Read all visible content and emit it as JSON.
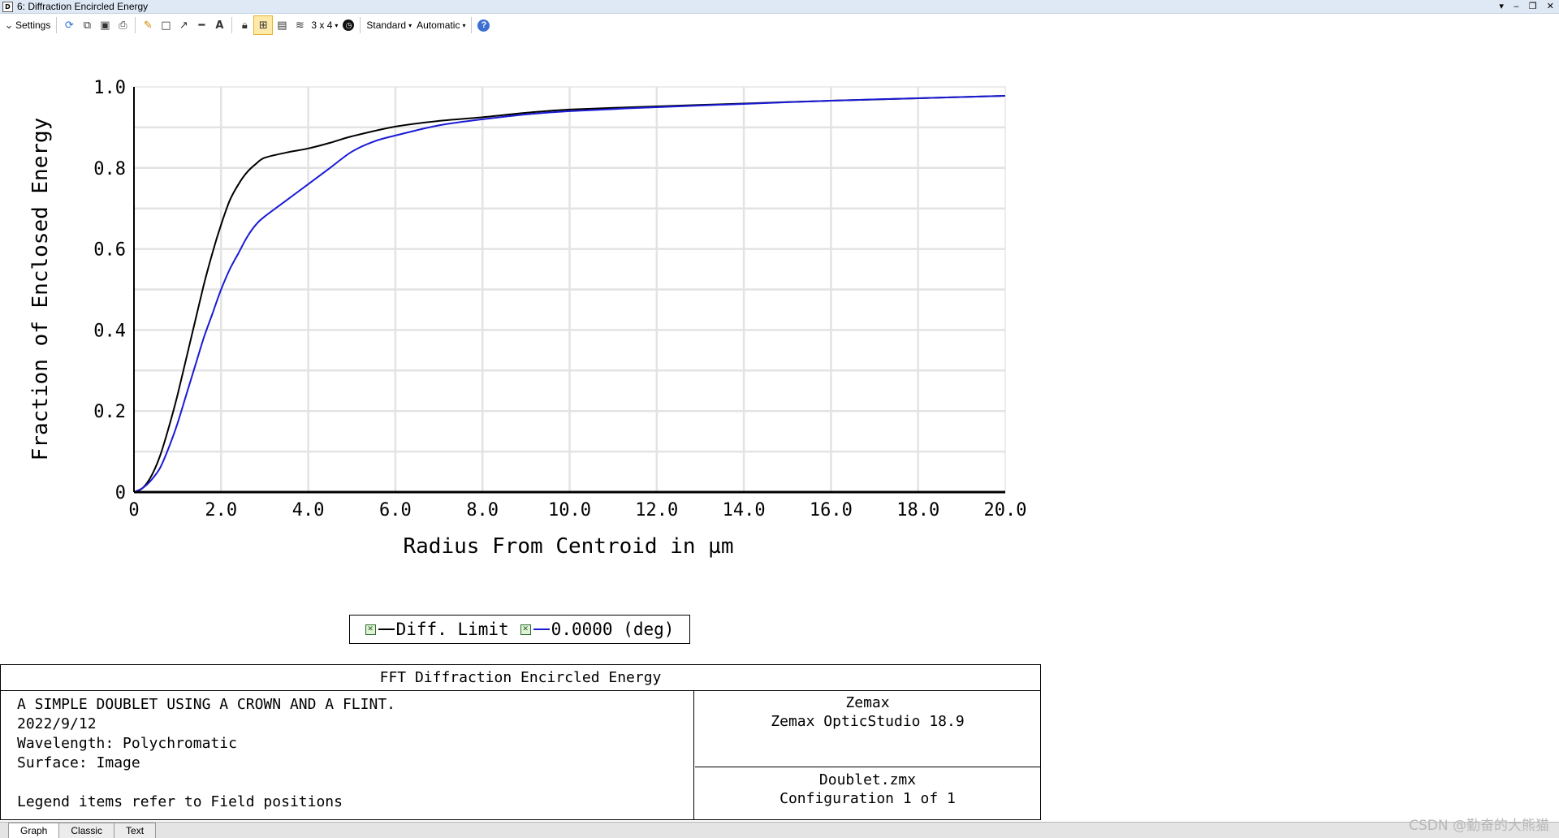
{
  "window": {
    "title": "6: Diffraction Encircled Energy",
    "icon_letter": "D"
  },
  "toolbar": {
    "settings_label": "Settings",
    "grid_label": "3 x 4",
    "standard_label": "Standard",
    "automatic_label": "Automatic"
  },
  "legend": {
    "item1": "Diff. Limit",
    "item2": "0.0000 (deg)",
    "item1_color": "#000000",
    "item2_color": "#1a1ad6"
  },
  "info": {
    "title": "FFT Diffraction Encircled Energy",
    "left_lines": [
      "A SIMPLE DOUBLET USING A CROWN AND A FLINT.",
      "2022/9/12",
      "Wavelength: Polychromatic",
      "Surface: Image",
      "Legend items refer to Field positions"
    ],
    "right_top": [
      "Zemax",
      "Zemax OpticStudio 18.9"
    ],
    "right_bottom": [
      "Doublet.zmx",
      "Configuration 1 of 1"
    ]
  },
  "tabs": [
    "Graph",
    "Classic",
    "Text"
  ],
  "watermark": "CSDN @勤奋的大熊猫",
  "chart_data": {
    "type": "line",
    "xlabel": "Radius From Centroid in µm",
    "ylabel": "Fraction of Enclosed Energy",
    "xlim": [
      0,
      20
    ],
    "ylim": [
      0,
      1
    ],
    "x_ticks": [
      "0",
      "2.0",
      "4.0",
      "6.0",
      "8.0",
      "10.0",
      "12.0",
      "14.0",
      "16.0",
      "18.0",
      "20.0"
    ],
    "y_ticks": [
      "0",
      "0.2",
      "0.4",
      "0.6",
      "0.8",
      "1.0"
    ],
    "grid": true,
    "series": [
      {
        "name": "Diff. Limit",
        "color": "#000000",
        "x": [
          0,
          0.2,
          0.4,
          0.6,
          0.8,
          1.0,
          1.2,
          1.4,
          1.6,
          1.8,
          2.0,
          2.2,
          2.4,
          2.6,
          2.8,
          3.0,
          3.5,
          4.0,
          4.5,
          5.0,
          6.0,
          7.0,
          8.0,
          9.0,
          10.0,
          12.0,
          14.0,
          16.0,
          18.0,
          20.0
        ],
        "y": [
          0,
          0.01,
          0.04,
          0.09,
          0.16,
          0.24,
          0.33,
          0.42,
          0.51,
          0.59,
          0.66,
          0.72,
          0.76,
          0.79,
          0.81,
          0.825,
          0.838,
          0.848,
          0.862,
          0.878,
          0.902,
          0.916,
          0.925,
          0.936,
          0.944,
          0.952,
          0.959,
          0.966,
          0.972,
          0.978
        ]
      },
      {
        "name": "0.0000 (deg)",
        "color": "#1a1ad6",
        "x": [
          0,
          0.2,
          0.4,
          0.6,
          0.8,
          1.0,
          1.2,
          1.4,
          1.6,
          1.8,
          2.0,
          2.2,
          2.4,
          2.6,
          2.8,
          3.0,
          3.5,
          4.0,
          4.5,
          5.0,
          5.5,
          6.0,
          7.0,
          8.0,
          9.0,
          10.0,
          12.0,
          14.0,
          16.0,
          18.0,
          20.0
        ],
        "y": [
          0,
          0.01,
          0.03,
          0.06,
          0.11,
          0.17,
          0.24,
          0.31,
          0.38,
          0.44,
          0.5,
          0.55,
          0.59,
          0.63,
          0.66,
          0.68,
          0.72,
          0.76,
          0.8,
          0.84,
          0.865,
          0.88,
          0.905,
          0.92,
          0.932,
          0.94,
          0.95,
          0.958,
          0.966,
          0.972,
          0.978
        ]
      }
    ]
  }
}
